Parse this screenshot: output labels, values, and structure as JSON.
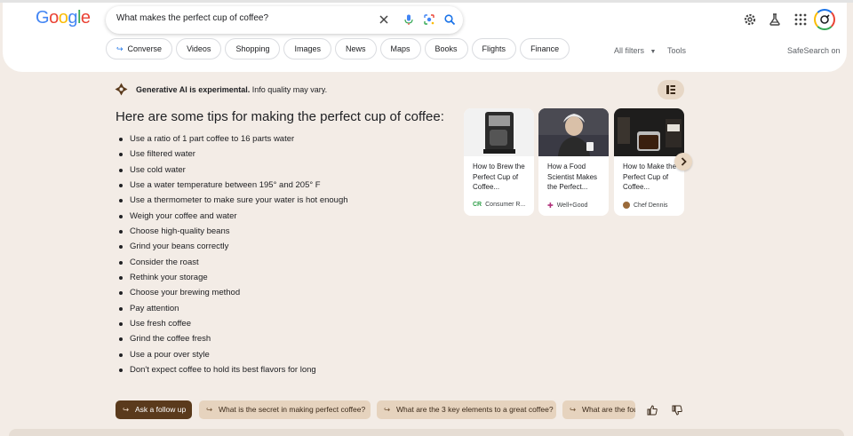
{
  "header": {
    "logo": [
      "G",
      "o",
      "o",
      "g",
      "l",
      "e"
    ],
    "logo_colors": [
      "#4285f4",
      "#ea4335",
      "#fbbc05",
      "#4285f4",
      "#34a853",
      "#ea4335"
    ],
    "search_query": "What makes the perfect cup of coffee?",
    "icons": [
      "clear-icon",
      "mic-icon",
      "lens-icon",
      "search-icon",
      "settings-icon",
      "labs-icon",
      "apps-icon",
      "account-avatar"
    ],
    "chips": [
      {
        "label": "Converse",
        "icon": "arrow-return-icon"
      },
      {
        "label": "Videos"
      },
      {
        "label": "Shopping"
      },
      {
        "label": "Images"
      },
      {
        "label": "News"
      },
      {
        "label": "Maps"
      },
      {
        "label": "Books"
      },
      {
        "label": "Flights"
      },
      {
        "label": "Finance"
      }
    ],
    "all_filters": "All filters",
    "tools": "Tools",
    "safesearch": "SafeSearch on"
  },
  "ai": {
    "notice_bold": "Generative AI is experimental.",
    "notice_rest": " Info quality may vary.",
    "intro": "Here are some tips for making the perfect cup of coffee:",
    "tips": [
      "Use a ratio of 1 part coffee to 16 parts water",
      "Use filtered water",
      "Use cold water",
      "Use a water temperature between 195° and 205° F",
      "Use a thermometer to make sure your water is hot enough",
      "Weigh your coffee and water",
      "Choose high-quality beans",
      "Grind your beans correctly",
      "Consider the roast",
      "Rethink your storage",
      "Choose your brewing method",
      "Pay attention",
      "Use fresh coffee",
      "Grind the coffee fresh",
      "Use a pour over style",
      "Don't expect coffee to hold its best flavors for long"
    ],
    "cards": [
      {
        "title": "How to Brew the Perfect Cup of Coffee...",
        "source": "Consumer R...",
        "source_color": "#2e9e48",
        "source_icon": "CR"
      },
      {
        "title": "How a Food Scientist Makes the Perfect...",
        "source": "Well+Good",
        "source_color": "#b0307a",
        "source_icon": "✚"
      },
      {
        "title": "How to Make the Perfect Cup of Coffee...",
        "source": "Chef Dennis",
        "source_color": "#9a6a3a",
        "source_icon": ""
      }
    ]
  },
  "followup": {
    "ask_label": "Ask a follow up",
    "suggestions": [
      "What is the secret in making perfect coffee?",
      "What are the 3 key elements to a great coffee?",
      "What are the four"
    ]
  },
  "colors": {
    "page_bg": "#f3ece6",
    "accent_blue": "#1a73e8",
    "followup_dark": "#5a3a1c",
    "suggestion_bg": "#e6d3be"
  }
}
